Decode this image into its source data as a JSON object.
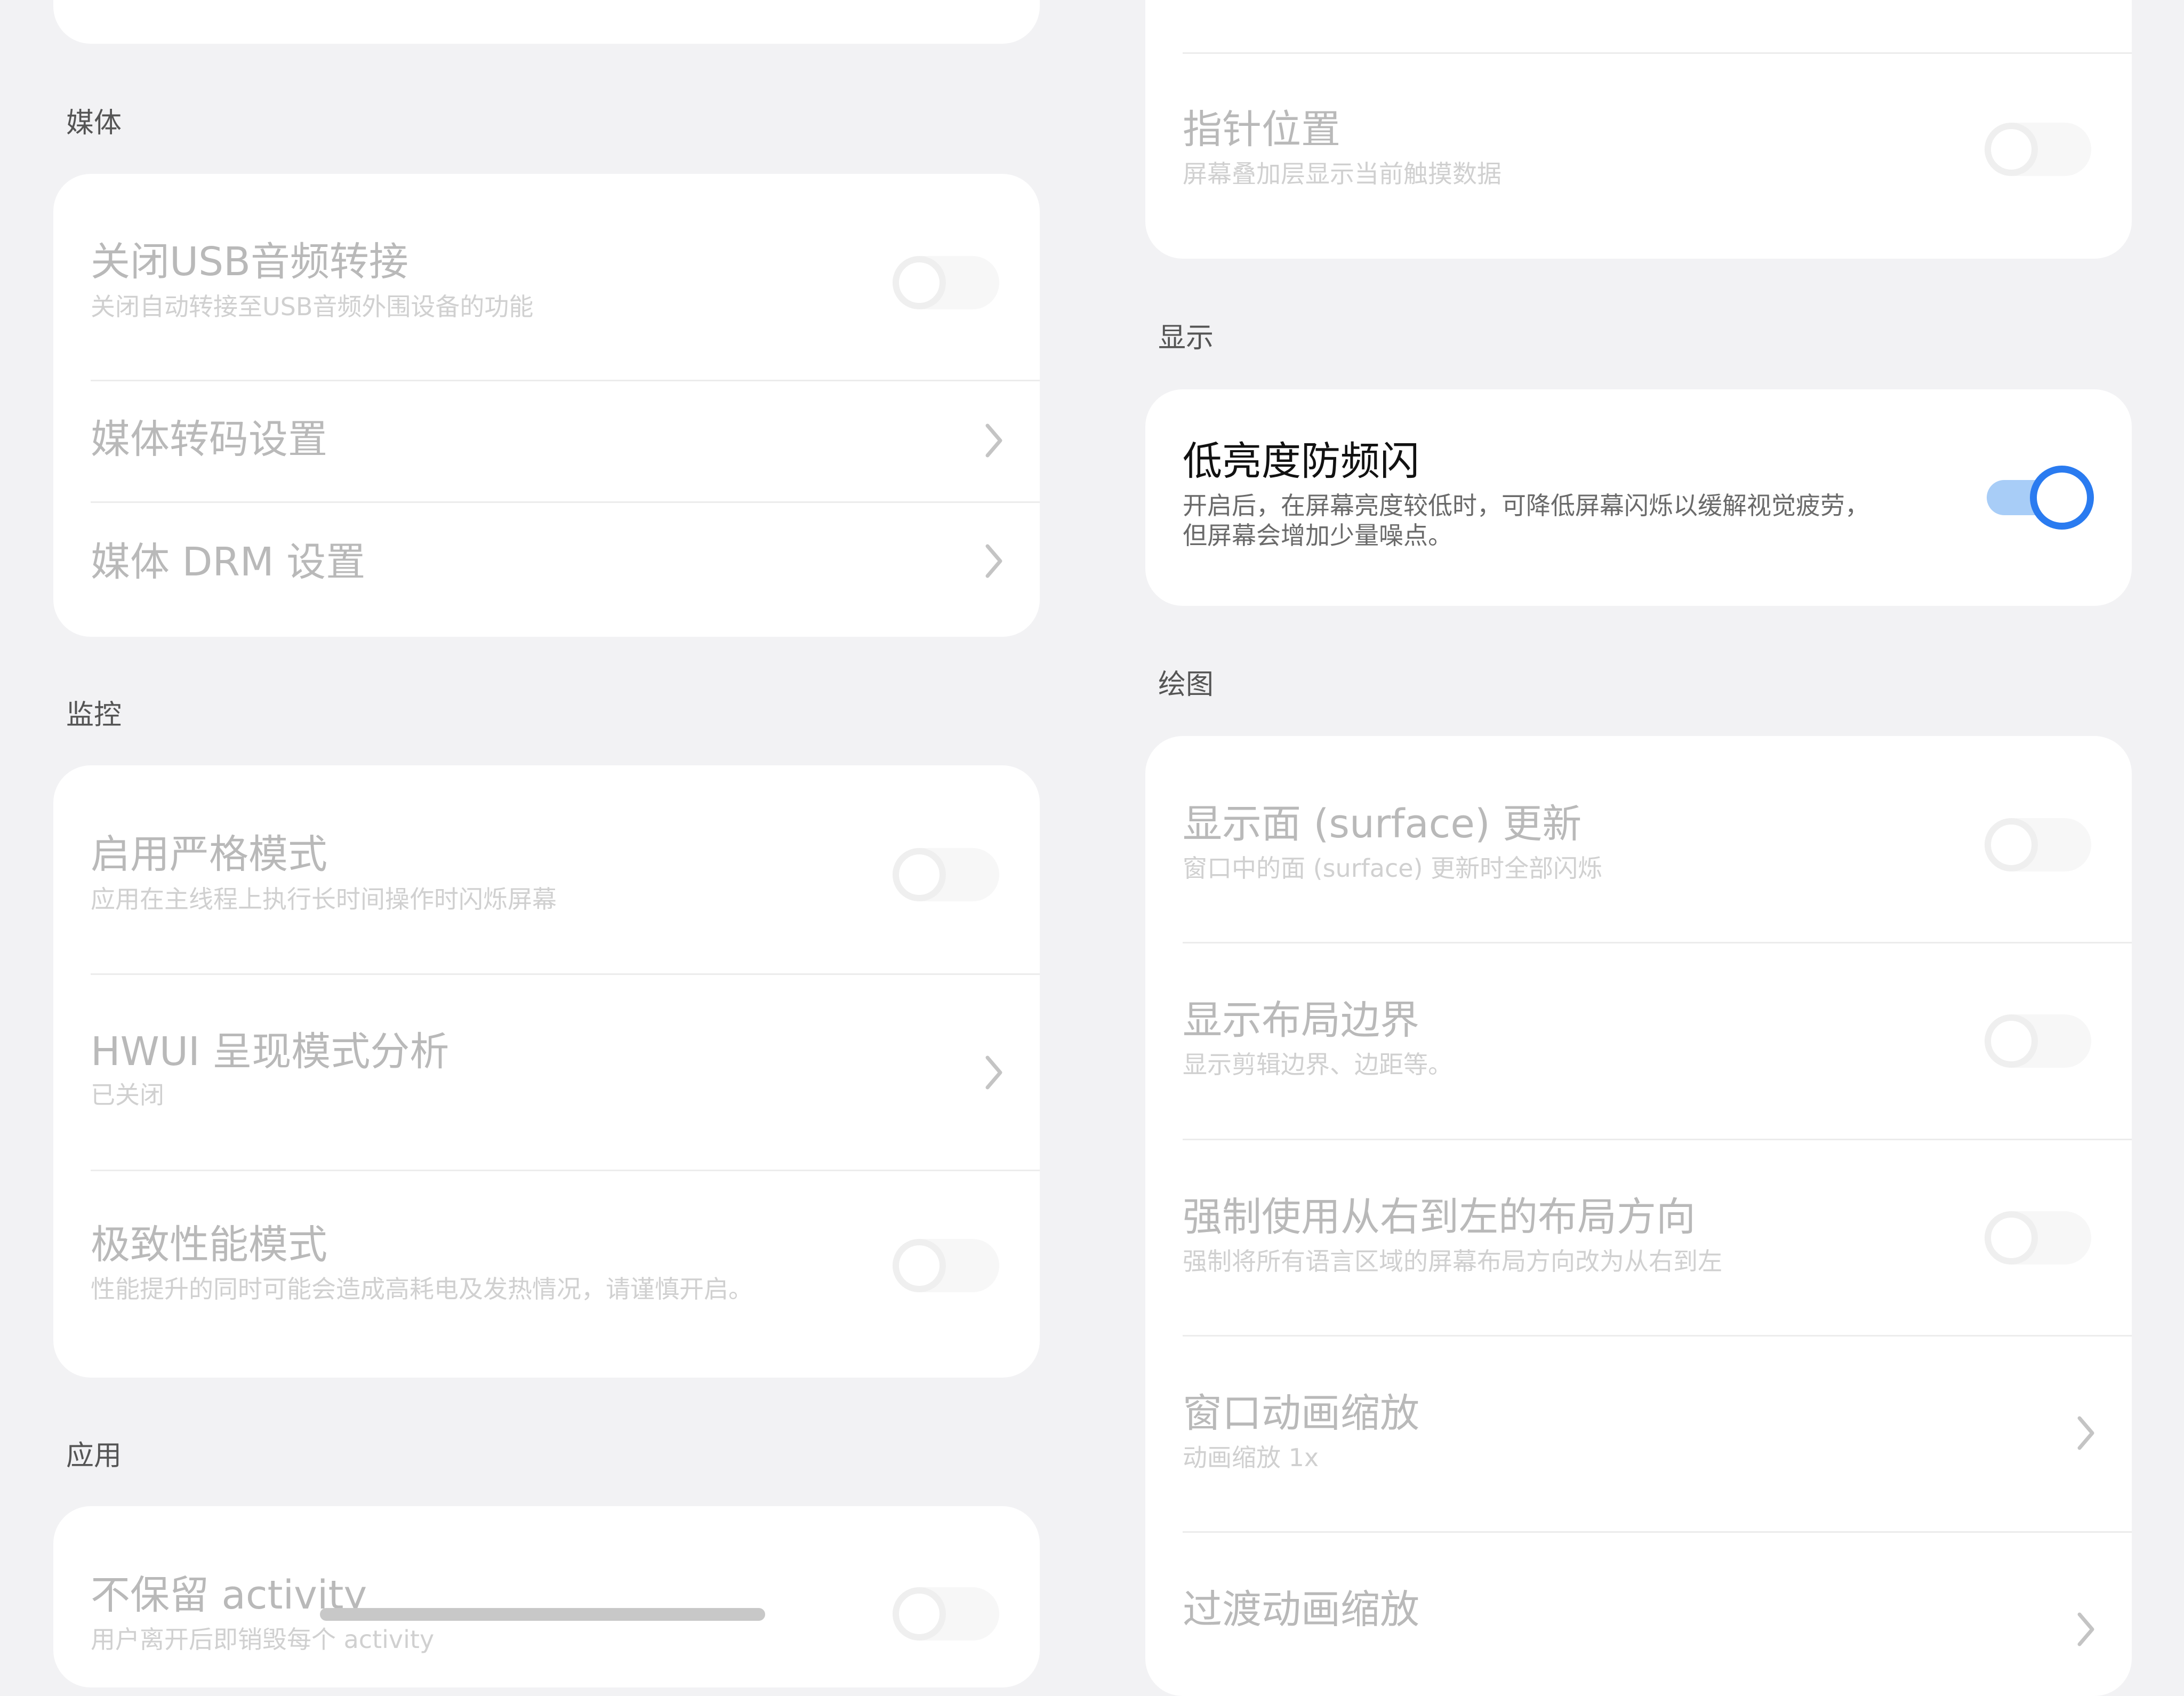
{
  "colors": {
    "background": "#f2f2f4",
    "card": "#ffffff",
    "accent": "#2a7bf0",
    "accent_track": "#a8cdf7",
    "disabled_text": "#b9b9b9"
  },
  "left": {
    "media": {
      "title": "媒体",
      "items": [
        {
          "title": "关闭USB音频转接",
          "subtitle": "关闭自动转接至USB音频外围设备的功能",
          "control": "toggle",
          "checked": false,
          "enabled": false
        },
        {
          "title": "媒体转码设置",
          "control": "chevron",
          "enabled": false
        },
        {
          "title": "媒体 DRM 设置",
          "control": "chevron",
          "enabled": false
        }
      ]
    },
    "monitor": {
      "title": "监控",
      "items": [
        {
          "title": "启用严格模式",
          "subtitle": "应用在主线程上执行长时间操作时闪烁屏幕",
          "control": "toggle",
          "checked": false,
          "enabled": false
        },
        {
          "title": "HWUI 呈现模式分析",
          "subtitle": "已关闭",
          "control": "chevron",
          "enabled": false
        },
        {
          "title": "极致性能模式",
          "subtitle": "性能提升的同时可能会造成高耗电及发热情况，请谨慎开启。",
          "control": "toggle",
          "checked": false,
          "enabled": false
        }
      ]
    },
    "apps": {
      "title": "应用",
      "items": [
        {
          "title": "不保留 activity",
          "subtitle": "用户离开后即销毁每个 activity",
          "control": "toggle",
          "checked": false,
          "enabled": false
        }
      ]
    }
  },
  "right": {
    "input": {
      "items": [
        {
          "title": "指针位置",
          "subtitle": "屏幕叠加层显示当前触摸数据",
          "control": "toggle",
          "checked": false,
          "enabled": false
        }
      ]
    },
    "display": {
      "title": "显示",
      "items": [
        {
          "title": "低亮度防频闪",
          "subtitle_line1": "开启后，在屏幕亮度较低时，可降低屏幕闪烁以缓解视觉疲劳，",
          "subtitle_line2": "但屏幕会增加少量噪点。",
          "control": "toggle",
          "checked": true,
          "enabled": true
        }
      ]
    },
    "drawing": {
      "title": "绘图",
      "items": [
        {
          "title": "显示面 (surface) 更新",
          "subtitle": "窗口中的面 (surface) 更新时全部闪烁",
          "control": "toggle",
          "checked": false,
          "enabled": false
        },
        {
          "title": "显示布局边界",
          "subtitle": "显示剪辑边界、边距等。",
          "control": "toggle",
          "checked": false,
          "enabled": false
        },
        {
          "title": "强制使用从右到左的布局方向",
          "subtitle": "强制将所有语言区域的屏幕布局方向改为从右到左",
          "control": "toggle",
          "checked": false,
          "enabled": false
        },
        {
          "title": "窗口动画缩放",
          "subtitle": "动画缩放 1x",
          "control": "chevron",
          "enabled": false
        },
        {
          "title": "过渡动画缩放",
          "control": "chevron",
          "enabled": false
        }
      ]
    }
  }
}
